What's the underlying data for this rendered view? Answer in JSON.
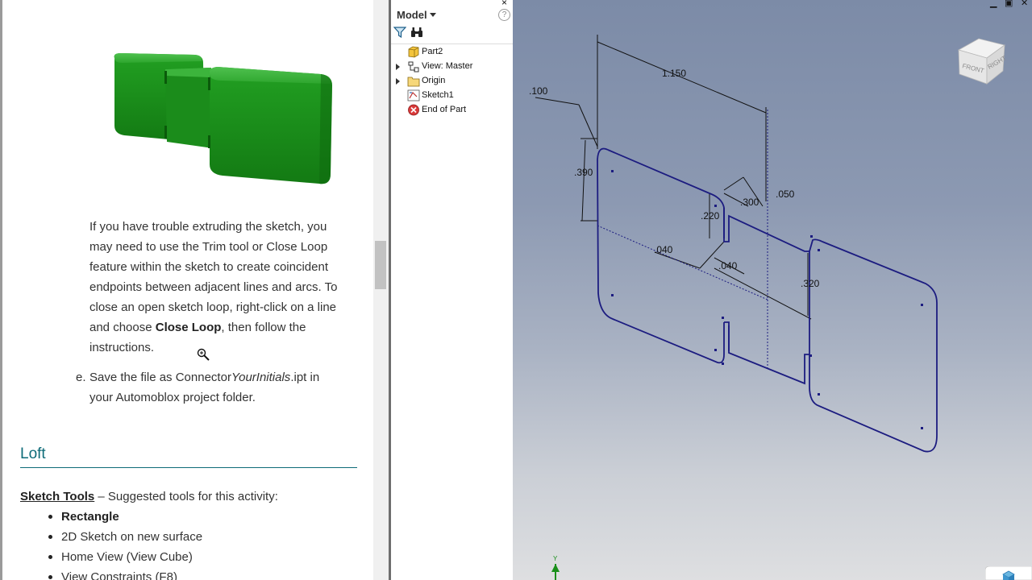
{
  "document": {
    "paragraph_trouble": {
      "line1": "If you have trouble extruding the sketch, you",
      "line2": "may need to use the Trim tool or Close Loop",
      "line3": "feature within the sketch to create coincident",
      "line4": "endpoints between adjacent lines and arcs. To",
      "line5": "close an open sketch loop, right-click on a line",
      "line6_pre": "and choose ",
      "line6_bold": "Close Loop",
      "line6_post": ", then follow the",
      "line7": "instructions."
    },
    "step_e": {
      "letter": "e.",
      "pre": "Save the file as Connector",
      "italic": "YourInitials",
      "post": ".ipt in",
      "line2": "your Automoblox project folder."
    },
    "loft_heading": "Loft",
    "sketch_tools_label": "Sketch Tools",
    "sketch_tools_suffix": " – Suggested tools for this activity:",
    "tools": [
      "Rectangle",
      "2D Sketch on new surface",
      "Home View (View Cube)",
      "View Constraints (F8)"
    ]
  },
  "browser": {
    "title": "Model",
    "help": "?",
    "close": "×",
    "tree": [
      {
        "label": "Part2",
        "icon": "part-icon",
        "expandable": false
      },
      {
        "label": "View: Master",
        "icon": "view-rep-icon",
        "expandable": true
      },
      {
        "label": "Origin",
        "icon": "folder-icon",
        "expandable": true
      },
      {
        "label": "Sketch1",
        "icon": "sketch-icon",
        "expandable": false
      },
      {
        "label": "End of Part",
        "icon": "end-of-part-icon",
        "expandable": false
      }
    ]
  },
  "viewport": {
    "dimensions": {
      "overall_length": "1.150",
      "corner_radius": ".100",
      "height": ".390",
      "notch_height": ".220",
      "notch_offset": ".300",
      "notch_gap": ".050",
      "slot_width_a": ".040",
      "slot_width_b": ".040",
      "right_height": ".320"
    },
    "view_cube": {
      "front": "FRONT",
      "right": "RIGHT"
    },
    "axis_label": "Y"
  },
  "colors": {
    "sketch_line": "#1c1c80",
    "dimension_line": "#111111",
    "heading_teal": "#0d6b78",
    "model_green": "#1a8f1a"
  }
}
